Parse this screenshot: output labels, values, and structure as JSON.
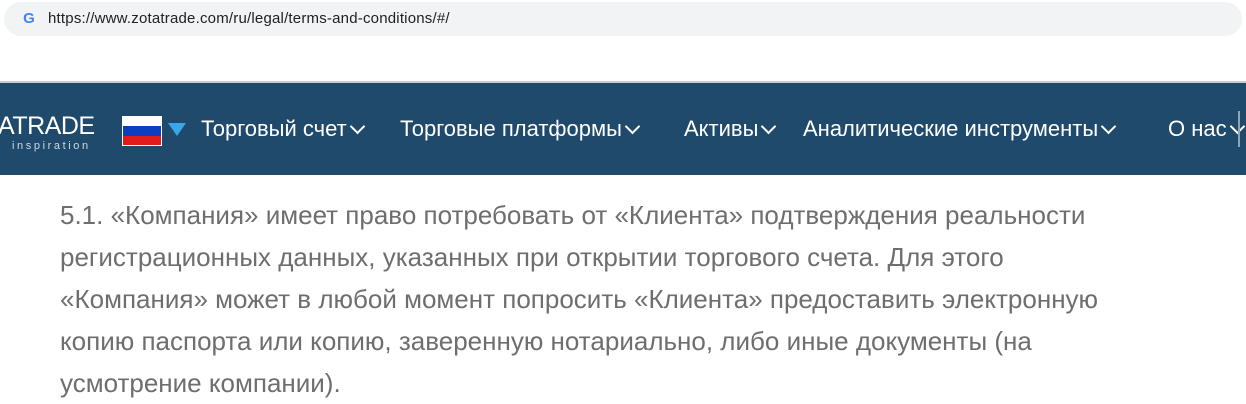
{
  "browser": {
    "url": "https://www.zotatrade.com/ru/legal/terms-and-conditions/#/",
    "favicon": "google-g-icon"
  },
  "nav": {
    "logo_main": "ATRADE",
    "logo_sub": "inspiration",
    "language_flag": "ru-flag-icon",
    "items": [
      {
        "label": "Торговый счет"
      },
      {
        "label": "Торговые платформы"
      },
      {
        "label": "Активы"
      },
      {
        "label": "Аналитические инструменты"
      },
      {
        "label": "О нас"
      }
    ]
  },
  "content": {
    "lines": [
      "5.1. «Компания» имеет право потребовать от «Клиента» подтверждения реальности",
      "регистрационных данных, указанных при открытии торгового счета. Для этого",
      "«Компания» может в любой момент попросить «Клиента» предоставить электронную",
      "копию паспорта или копию, заверенную нотариально, либо иные документы (на",
      "усмотрение компании)."
    ]
  },
  "colors": {
    "navbar_bg": "#1f4a6b",
    "text": "#6e6e6e",
    "accent": "#3aa6e8"
  }
}
